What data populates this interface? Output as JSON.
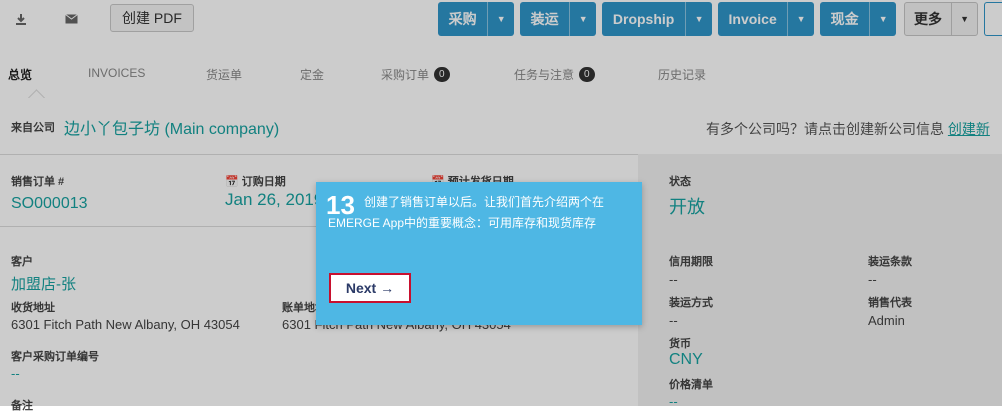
{
  "toolbar": {
    "download_icon": "download-icon",
    "mail_icon": "envelope-icon",
    "pdf_label": "创建 PDF",
    "buttons": [
      {
        "label": "采购"
      },
      {
        "label": "装运"
      },
      {
        "label": "Dropship"
      },
      {
        "label": "Invoice"
      },
      {
        "label": "现金"
      },
      {
        "label": "更多"
      }
    ],
    "caret": "▼"
  },
  "tabs": [
    {
      "label": "总览"
    },
    {
      "label": "INVOICES"
    },
    {
      "label": "货运单"
    },
    {
      "label": "定金"
    },
    {
      "label": "采购订单",
      "badge": "0"
    },
    {
      "label": "任务与注意",
      "badge": "0"
    },
    {
      "label": "历史记录"
    }
  ],
  "company": {
    "from_label": "来自公司",
    "name": "边小丫包子坊 (Main company)",
    "hint": "有多个公司吗？请点击创建新公司信息",
    "link": "创建新"
  },
  "order": {
    "so_label": "销售订单 #",
    "so_value": "SO000013",
    "order_date_label": "订购日期",
    "order_date_value": "Jan 26, 2019",
    "ship_date_label": "预计发货日期",
    "customer_label": "客户",
    "customer_value": "加盟店-张",
    "ship_addr_label": "收货地址",
    "ship_addr_value": "6301 Fitch Path New Albany, OH 43054",
    "bill_addr_label": "账单地址",
    "bill_addr_value": "6301 Fitch Path New Albany, OH 43054",
    "po_label": "客户采购订单编号",
    "po_value": "--",
    "notes_label": "备注"
  },
  "side": {
    "status_label": "状态",
    "status_value": "开放",
    "credit_label": "信用期限",
    "credit_value": "--",
    "shipterms_label": "装运条款",
    "shipterms_value": "--",
    "shipmethod_label": "装运方式",
    "shipmethod_value": "--",
    "rep_label": "销售代表",
    "rep_value": "Admin",
    "currency_label": "货币",
    "currency_value": "CNY",
    "pricelist_label": "价格清单",
    "pricelist_value": "--"
  },
  "tour": {
    "step": "13",
    "text": "创建了销售订单以后。让我们首先介绍两个在EMERGE App中的重要概念：可用库存和现货库存",
    "next_label": "Next →"
  }
}
